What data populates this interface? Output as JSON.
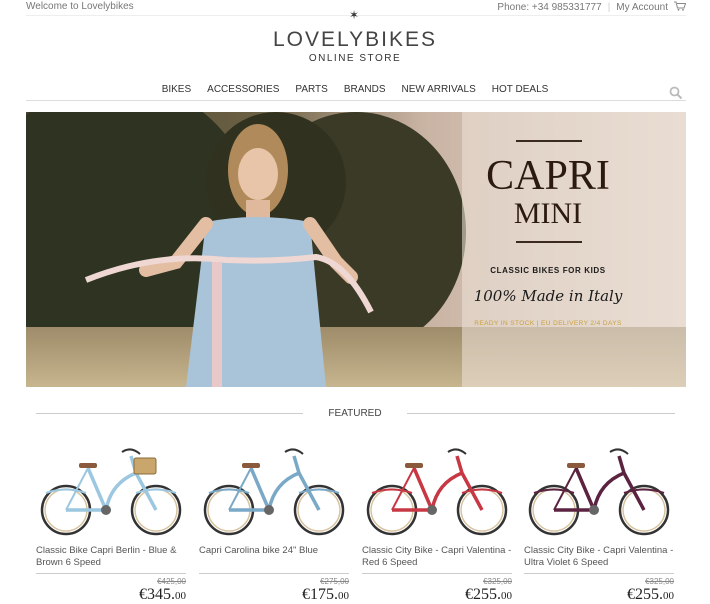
{
  "topbar": {
    "welcome": "Welcome to Lovelybikes",
    "phone": "Phone: +34 985331777",
    "account": "My Account",
    "cart_icon": "cart-icon"
  },
  "logo": {
    "title": "LOVELYBIKES",
    "subtitle": "ONLINE STORE",
    "star_icon": "star-icon"
  },
  "nav": {
    "items": [
      "BIKES",
      "ACCESSORIES",
      "PARTS",
      "BRANDS",
      "NEW ARRIVALS",
      "HOT DEALS"
    ],
    "search_icon": "search-icon"
  },
  "hero": {
    "title": "CAPRI",
    "subtitle": "MINI",
    "tagline": "CLASSIC BIKES FOR KIDS",
    "script": "100% Made in Italy",
    "stock": "READY IN STOCK | EU DELIVERY 2/4 DAYS"
  },
  "featured": {
    "label": "FEATURED"
  },
  "products": [
    {
      "name": "Classic Bike Capri Berlin - Blue & Brown 6 Speed",
      "old_price": "€425,00",
      "price": "€345.",
      "cents": "00",
      "frame_color": "#9cc7e0",
      "basket": true
    },
    {
      "name": "Capri Carolina bike 24\" Blue",
      "old_price": "€275,00",
      "price": "€175.",
      "cents": "00",
      "frame_color": "#7aa9c8",
      "basket": false
    },
    {
      "name": "Classic City Bike - Capri Valentina - Red 6 Speed",
      "old_price": "€325,00",
      "price": "€255.",
      "cents": "00",
      "frame_color": "#c73844",
      "basket": false
    },
    {
      "name": "Classic City Bike - Capri Valentina - Ultra Violet 6 Speed",
      "old_price": "€325,00",
      "price": "€255.",
      "cents": "00",
      "frame_color": "#5b2340",
      "basket": false
    }
  ]
}
